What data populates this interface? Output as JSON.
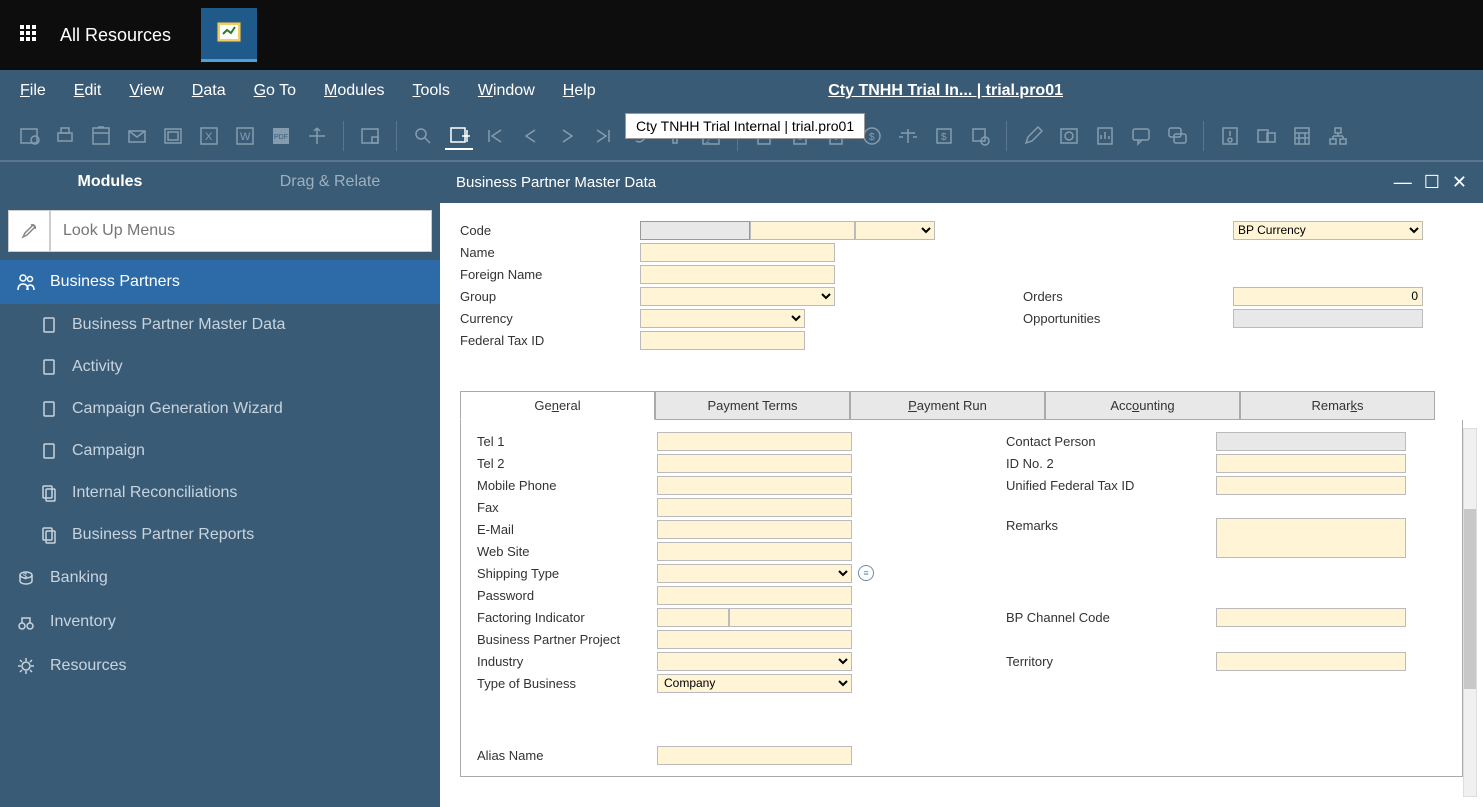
{
  "topBar": {
    "allResources": "All Resources"
  },
  "menuBar": {
    "file": "File",
    "edit": "Edit",
    "view": "View",
    "data": "Data",
    "goTo": "Go To",
    "modules": "Modules",
    "tools": "Tools",
    "window": "Window",
    "help": "Help",
    "companyTitle": "Cty TNHH Trial In... | trial.pro01"
  },
  "tooltip": "Cty TNHH Trial Internal | trial.pro01",
  "sidebar": {
    "tabs": {
      "modules": "Modules",
      "dragRelate": "Drag & Relate"
    },
    "searchPlaceholder": "Look Up Menus",
    "businessPartners": "Business Partners",
    "items": [
      "Business Partner Master Data",
      "Activity",
      "Campaign Generation Wizard",
      "Campaign",
      "Internal Reconciliations",
      "Business Partner Reports"
    ],
    "groups": {
      "banking": "Banking",
      "inventory": "Inventory",
      "resources": "Resources"
    }
  },
  "window": {
    "title": "Business Partner Master Data"
  },
  "header": {
    "labels": {
      "code": "Code",
      "name": "Name",
      "foreignName": "Foreign Name",
      "group": "Group",
      "currency": "Currency",
      "federalTaxId": "Federal Tax ID",
      "bpCurrency": "BP Currency",
      "orders": "Orders",
      "ordersValue": "0",
      "opportunities": "Opportunities"
    }
  },
  "tabs": {
    "general": "General",
    "paymentTerms": "Payment Terms",
    "paymentRun": "Payment Run",
    "accounting": "Accounting",
    "remarks": "Remarks"
  },
  "general": {
    "left": {
      "tel1": "Tel 1",
      "tel2": "Tel 2",
      "mobilePhone": "Mobile Phone",
      "fax": "Fax",
      "email": "E-Mail",
      "webSite": "Web Site",
      "shippingType": "Shipping Type",
      "password": "Password",
      "factoringIndicator": "Factoring Indicator",
      "bpProject": "Business Partner Project",
      "industry": "Industry",
      "typeOfBusiness": "Type of Business",
      "typeOfBusinessValue": "Company",
      "aliasName": "Alias Name"
    },
    "right": {
      "contactPerson": "Contact Person",
      "idNo2": "ID No. 2",
      "unifiedFederalTaxId": "Unified Federal Tax ID",
      "remarks": "Remarks",
      "bpChannelCode": "BP Channel Code",
      "territory": "Territory"
    }
  }
}
